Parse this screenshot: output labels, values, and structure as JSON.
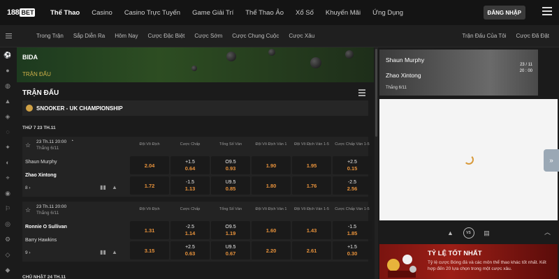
{
  "brand": {
    "logo_number": "188",
    "logo_text": "BET"
  },
  "nav": {
    "items": [
      "Thể Thao",
      "Casino",
      "Casino Trực Tuyến",
      "Game Giải Trí",
      "Thể Thao Ảo",
      "Xổ Số",
      "Khuyến Mãi",
      "Ứng Dụng"
    ],
    "active": "Thể Thao",
    "login_label": "ĐĂNG NHẬP"
  },
  "subnav": {
    "items": [
      "Trong Trận",
      "Sắp Diễn Ra",
      "Hôm Nay",
      "Cược Đặc Biệt",
      "Cược Sớm",
      "Cược Chung Cuộc",
      "Cược Xâu"
    ],
    "right_items": [
      "Trận Đấu Của Tôi",
      "Cược Đã Đặt"
    ]
  },
  "hero": {
    "title": "BIDA",
    "subtitle": "TRẬN ĐẤU"
  },
  "section_title": "TRẬN ĐẤU",
  "league": "SNOOKER - UK CHAMPIONSHIP",
  "columns": [
    "Đội Vô Địch",
    "Cược Chấp",
    "Tổng Số Ván",
    "Đội Vô Địch Ván 1",
    "Đội Vô Địch Ván 1-5",
    "Cược Chấp Ván 1-5"
  ],
  "days": [
    {
      "label": "THỨ 7 23 TH.11",
      "matches": [
        {
          "time": "23 Th.11 20:00",
          "date": "Thắng 6/11",
          "team1": "Shaun Murphy",
          "team2": "Zhao Xintong",
          "more": "8",
          "rows": [
            [
              {
                "line": "",
                "odd": "2.04"
              },
              {
                "line": "+1.5",
                "odd": "0.64"
              },
              {
                "line": "O9.5",
                "odd": "0.93"
              },
              {
                "line": "",
                "odd": "1.90"
              },
              {
                "line": "",
                "odd": "1.95"
              },
              {
                "line": "+2.5",
                "odd": "0.15"
              }
            ],
            [
              {
                "line": "",
                "odd": "1.72"
              },
              {
                "line": "-1.5",
                "odd": "1.13"
              },
              {
                "line": "U9.5",
                "odd": "0.85"
              },
              {
                "line": "",
                "odd": "1.80"
              },
              {
                "line": "",
                "odd": "1.76"
              },
              {
                "line": "-2.5",
                "odd": "2.56"
              }
            ]
          ]
        },
        {
          "time": "23 Th.11 20:00",
          "date": "Thắng 6/11",
          "team1": "Ronnie O Sullivan",
          "team2": "Barry Hawkins",
          "more": "9",
          "rows": [
            [
              {
                "line": "",
                "odd": "1.31"
              },
              {
                "line": "-2.5",
                "odd": "1.14"
              },
              {
                "line": "O9.5",
                "odd": "1.19"
              },
              {
                "line": "",
                "odd": "1.60"
              },
              {
                "line": "",
                "odd": "1.43"
              },
              {
                "line": "-1.5",
                "odd": "1.85"
              }
            ],
            [
              {
                "line": "",
                "odd": "3.15"
              },
              {
                "line": "+2.5",
                "odd": "0.63"
              },
              {
                "line": "U9.5",
                "odd": "0.67"
              },
              {
                "line": "",
                "odd": "2.20"
              },
              {
                "line": "",
                "odd": "2.61"
              },
              {
                "line": "+1.5",
                "odd": "0.30"
              }
            ]
          ]
        }
      ]
    },
    {
      "label": "CHỦ NHẬT 24 TH.11"
    }
  ],
  "scoreboard": {
    "player1": "Shaun Murphy",
    "player2": "Zhao Xintong",
    "date_label": "Thắng 6/11",
    "date_right": "23 / 11",
    "time_right": "20 : 00"
  },
  "promo": {
    "title": "TỶ LỆ TỐT NHẤT",
    "desc": "Tỷ lệ cược Bóng đá và các môn thể thao khác tốt nhất. Kết hợp đến 20 lựa chọn trong một cược xâu."
  },
  "colors": {
    "accent": "#e8923b",
    "brand_bg": "#141414",
    "gold": "#d0b24a"
  }
}
